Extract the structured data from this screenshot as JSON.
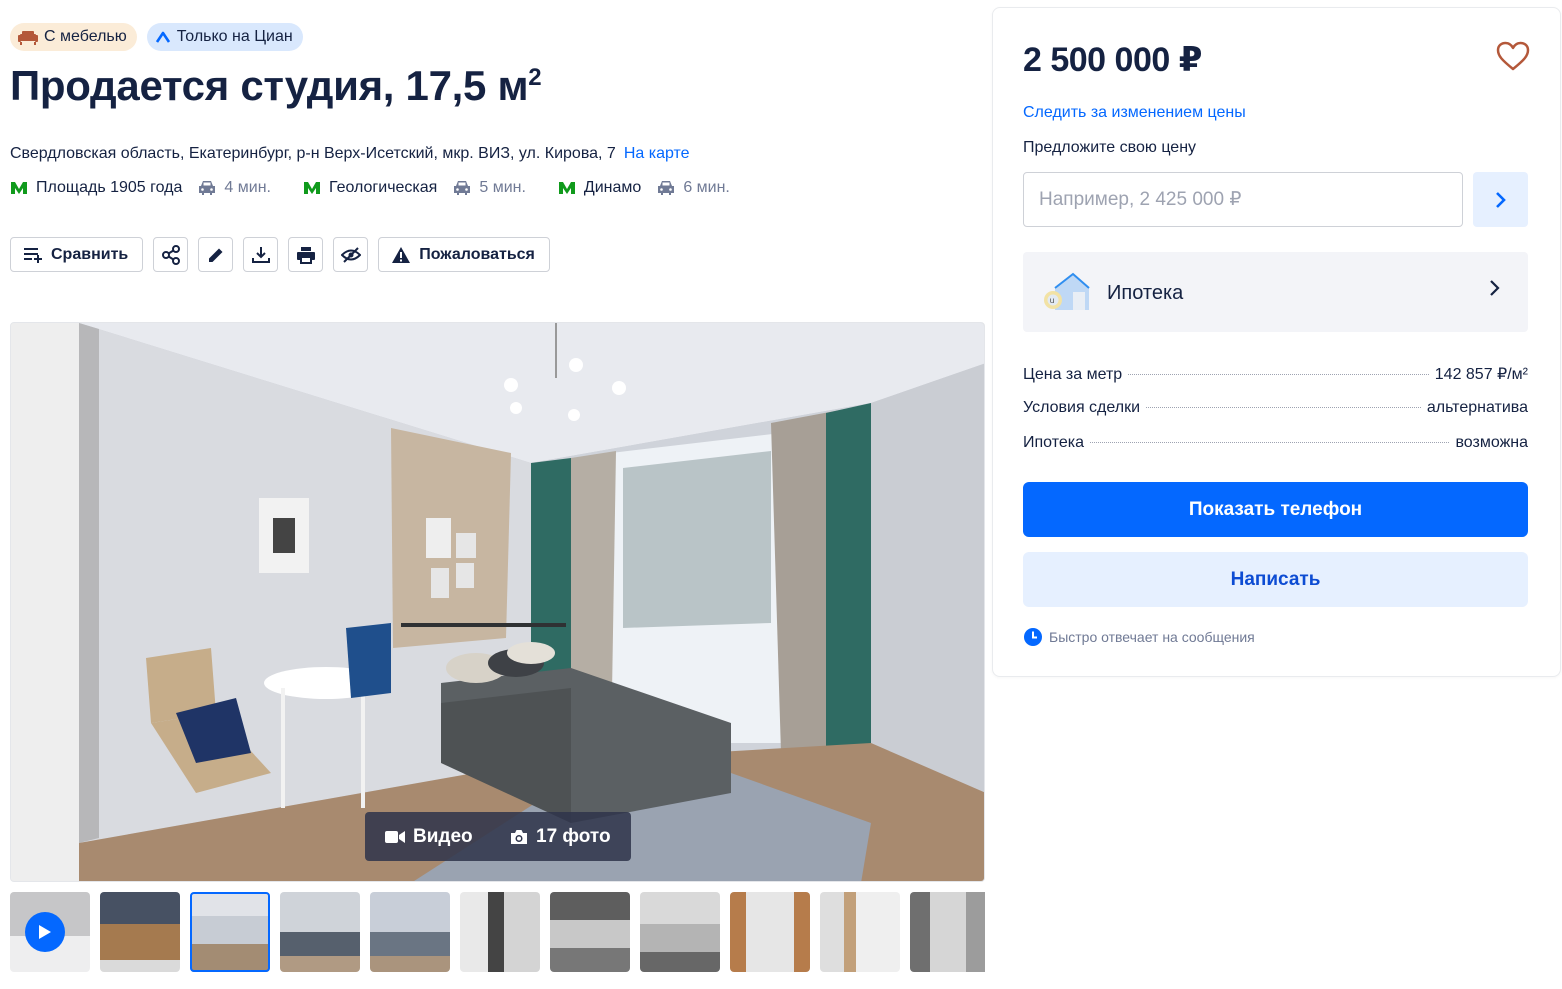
{
  "tags": {
    "furniture": "С мебелью",
    "cian_only": "Только на Циан"
  },
  "title": {
    "text": "Продается студия, 17,5 м",
    "sup": "2"
  },
  "address": {
    "text": "Свердловская область, Екатеринбург, р-н Верх-Исетский, мкр. ВИЗ, ул. Кирова, 7",
    "map_link": "На карте"
  },
  "metro": [
    {
      "name": "Площадь 1905 года",
      "time": "4 мин."
    },
    {
      "name": "Геологическая",
      "time": "5 мин."
    },
    {
      "name": "Динамо",
      "time": "6 мин."
    }
  ],
  "actions": {
    "compare": "Сравнить",
    "complain": "Пожаловаться"
  },
  "gallery": {
    "video": "Видео",
    "photos": "17 фото"
  },
  "sidebar": {
    "price": "2 500 000 ₽",
    "track_price": "Следить за изменением цены",
    "offer_label": "Предложите свою цену",
    "offer_placeholder": "Например, 2 425 000 ₽",
    "mortgage": "Ипотека",
    "params": [
      {
        "label": "Цена за метр",
        "value": "142 857 ₽/м²"
      },
      {
        "label": "Условия сделки",
        "value": "альтернатива"
      },
      {
        "label": "Ипотека",
        "value": "возможна"
      }
    ],
    "show_phone": "Показать телефон",
    "write": "Написать",
    "quick_reply": "Быстро отвечает на сообщения"
  },
  "colors": {
    "accent": "#0468ff",
    "text": "#152242",
    "muted": "#707a95",
    "metro": "#109a1c"
  },
  "icons": [
    "sofa-icon",
    "cian-logo-icon",
    "metro-icon",
    "car-icon",
    "compare-icon",
    "share-icon",
    "edit-icon",
    "download-icon",
    "print-icon",
    "hide-icon",
    "warning-icon",
    "video-camera-icon",
    "camera-icon",
    "play-icon",
    "heart-icon",
    "chevron-right-icon",
    "house-icon",
    "clock-icon"
  ]
}
